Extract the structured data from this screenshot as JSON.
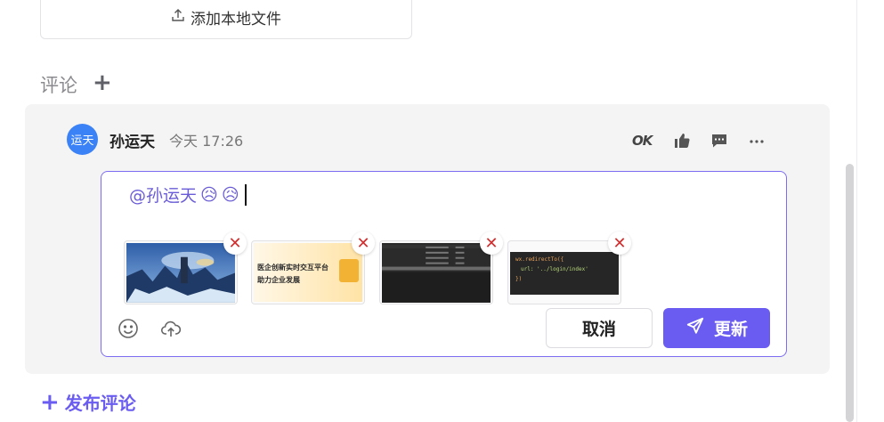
{
  "attachments": {
    "add_local_file_label": "添加本地文件"
  },
  "comments": {
    "title": "评论",
    "add_symbol": "+",
    "item": {
      "avatar_text": "运天",
      "author": "孙运天",
      "time": "今天 17:26",
      "actions": {
        "ok_label": "OK"
      }
    },
    "editor": {
      "mention": "@孙运天",
      "emojis": [
        "😥",
        "😥"
      ],
      "images": [
        {
          "name": "game-landscape-image"
        },
        {
          "name": "banner-image",
          "caption_line1": "医企创新实时交互平台",
          "caption_line2": "助力企业发展"
        },
        {
          "name": "log-table-screenshot"
        },
        {
          "name": "code-snippet-screenshot",
          "code_line1": "wx.redirectTo({",
          "code_line2": "url: '../login/index'",
          "code_line3": "})"
        }
      ],
      "remove_symbol": "✕",
      "cancel_label": "取消",
      "update_label": "更新"
    }
  },
  "publish_comment_label": "发布评论",
  "colors": {
    "accent": "#6a5cf0",
    "avatar": "#3b82f6",
    "panel": "#f4f4f5",
    "remove": "#d12f2f"
  }
}
